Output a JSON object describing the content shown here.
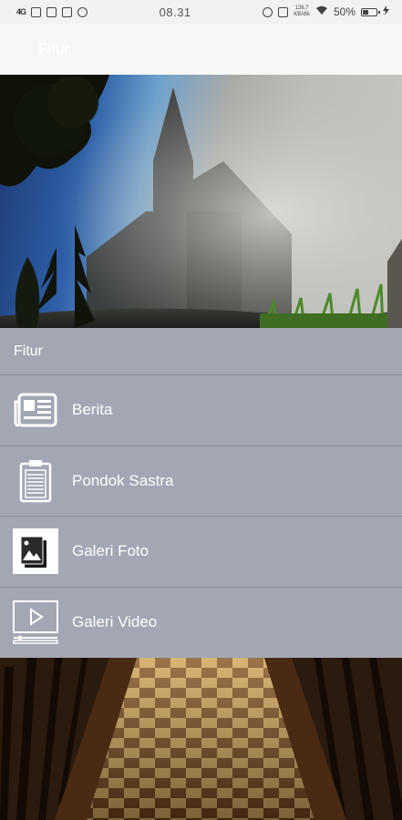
{
  "status_bar": {
    "signal": "4G",
    "time": "08.31",
    "speed_value": "126,7",
    "speed_unit": "KB/dtk",
    "battery": "50%"
  },
  "app_bar": {
    "title": "Fitur"
  },
  "menu": {
    "header": "Fitur",
    "items": [
      {
        "label": "Berita",
        "icon": "newspaper-icon"
      },
      {
        "label": "Pondok Sastra",
        "icon": "clipboard-icon"
      },
      {
        "label": "Galeri Foto",
        "icon": "photo-gallery-icon"
      },
      {
        "label": "Galeri Video",
        "icon": "video-player-icon"
      }
    ]
  },
  "colors": {
    "menu_background": "#a2a7b3",
    "divider": "#8a8f9b",
    "app_bar": "#f7f7f7"
  }
}
